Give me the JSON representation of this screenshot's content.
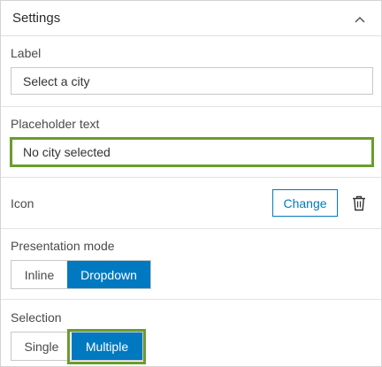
{
  "header": {
    "title": "Settings",
    "collapse_icon": "chevron-up-icon"
  },
  "label_field": {
    "label": "Label",
    "value": "Select a city"
  },
  "placeholder_field": {
    "label": "Placeholder text",
    "value": "No city selected"
  },
  "icon_row": {
    "label": "Icon",
    "change_label": "Change",
    "delete_icon": "trash-icon"
  },
  "presentation_mode": {
    "label": "Presentation mode",
    "options": [
      "Inline",
      "Dropdown"
    ],
    "selected": "Dropdown"
  },
  "selection": {
    "label": "Selection",
    "options": [
      "Single",
      "Multiple"
    ],
    "selected": "Multiple"
  },
  "colors": {
    "accent": "#0079c1",
    "highlight": "#6a9c2e"
  }
}
